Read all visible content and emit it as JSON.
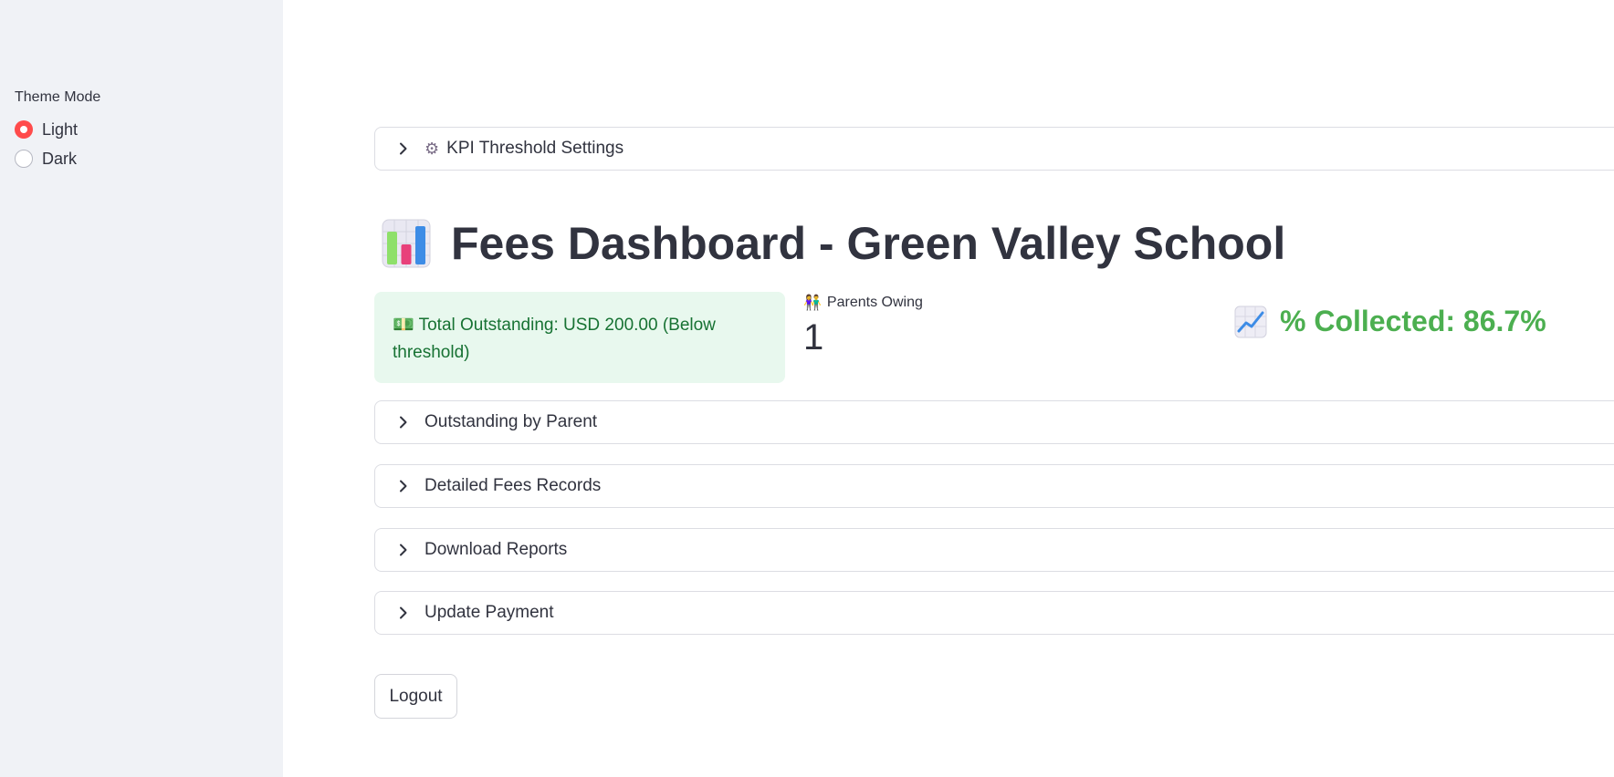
{
  "sidebar": {
    "theme_title": "Theme Mode",
    "options": [
      {
        "label": "Light",
        "selected": true
      },
      {
        "label": "Dark",
        "selected": false
      }
    ]
  },
  "kpi_expander": {
    "icon": "gear-icon",
    "label": "KPI Threshold Settings"
  },
  "page": {
    "title": "Fees Dashboard - Green Valley School",
    "title_icon": "bar-chart-icon"
  },
  "kpis": {
    "outstanding_text": "Total Outstanding: USD 200.00 (Below threshold)",
    "outstanding_icon": "money-icon",
    "parents_label": "Parents Owing",
    "parents_icon": "people-icon",
    "parents_value": "1",
    "collected_text": "% Collected: 86.7%",
    "collected_icon": "trend-up-chart-icon"
  },
  "expanders": [
    {
      "label": "Outstanding by Parent"
    },
    {
      "label": "Detailed Fees Records"
    },
    {
      "label": "Download Reports"
    },
    {
      "label": "Update Payment"
    }
  ],
  "logout_label": "Logout",
  "colors": {
    "accent": "#ff4b4b",
    "success_bg": "#e8f8ee",
    "success_text": "#177233",
    "collected_green": "#4caf50",
    "sidebar_bg": "#f0f2f6"
  }
}
